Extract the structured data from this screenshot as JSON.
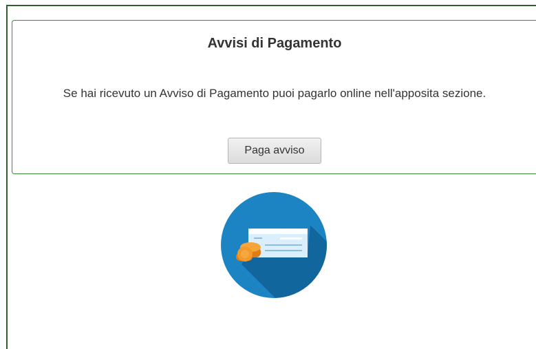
{
  "panel": {
    "title": "Avvisi di Pagamento",
    "description": "Se hai ricevuto un Avviso di Pagamento puoi pagarlo online nell'apposita sezione.",
    "button_label": "Paga avviso"
  },
  "illustration": {
    "icon": "payment-slip-coins-icon",
    "colors": {
      "circle": "#1c84c2",
      "shadow": "#0f6097",
      "slip": "#dbeefb",
      "coins": "#f39a2a"
    }
  }
}
